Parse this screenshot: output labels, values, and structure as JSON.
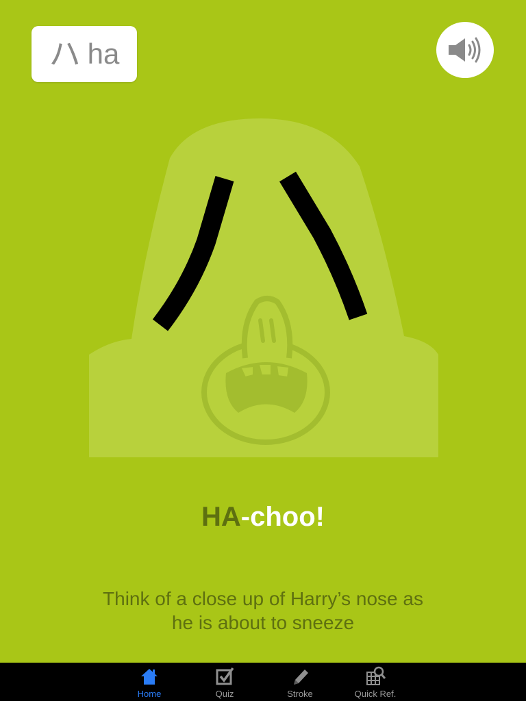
{
  "kana_card": {
    "kana": "ハ",
    "romaji": "ha"
  },
  "sound_button": {
    "icon": "speaker-icon"
  },
  "caption": {
    "highlight": "HA",
    "rest": "-choo!"
  },
  "hint": "Think of a close up of Harry’s nose as he is about to sneeze",
  "colors": {
    "background": "#a9c617",
    "head": "#b8d13c",
    "face_line": "#a3bd2f",
    "caption_highlight": "#5e7010",
    "tab_active": "#2a7cf6",
    "tab_inactive": "#9a9a9a"
  },
  "tabs": [
    {
      "label": "Home",
      "icon": "home-icon",
      "active": true
    },
    {
      "label": "Quiz",
      "icon": "checkbox-icon",
      "active": false
    },
    {
      "label": "Stroke",
      "icon": "pencil-icon",
      "active": false
    },
    {
      "label": "Quick Ref.",
      "icon": "grid-search-icon",
      "active": false
    }
  ]
}
